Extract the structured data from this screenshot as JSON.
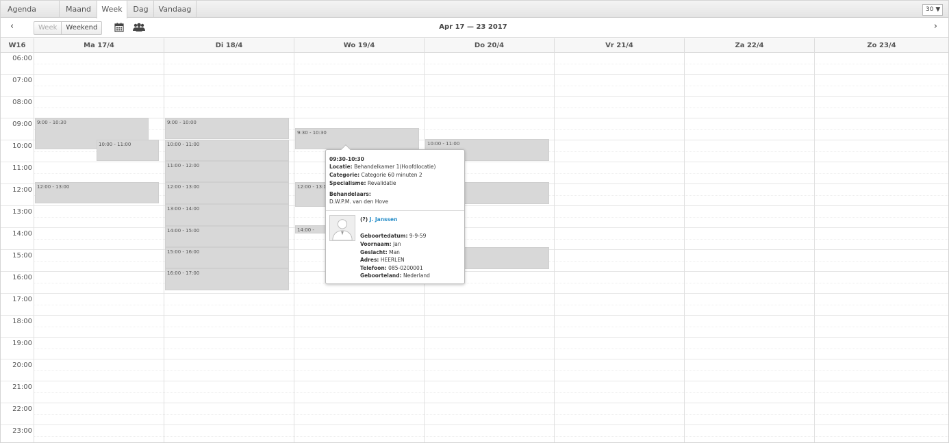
{
  "tabs": {
    "agenda": "Agenda",
    "maand": "Maand",
    "week": "Week",
    "dag": "Dag",
    "vandaag": "Vandaag"
  },
  "slot_select": "30 ▼",
  "toolbar": {
    "prev": "‹",
    "next": "›",
    "week_btn": "Week",
    "weekend_btn": "Weekend",
    "range_title": "Apr 17 — 23 2017",
    "calendar_icon": "calendar-icon",
    "people_icon": "people-icon"
  },
  "header": {
    "week_number": "W16",
    "days": [
      "Ma 17/4",
      "Di 18/4",
      "Wo 19/4",
      "Do 20/4",
      "Vr 21/4",
      "Za 22/4",
      "Zo 23/4"
    ]
  },
  "hours": [
    "06:00",
    "07:00",
    "08:00",
    "09:00",
    "10:00",
    "11:00",
    "12:00",
    "13:00",
    "14:00",
    "15:00",
    "16:00",
    "17:00",
    "18:00",
    "19:00",
    "20:00",
    "21:00",
    "22:00",
    "23:00"
  ],
  "events": [
    {
      "day": 0,
      "label": "9:00 - 10:30"
    },
    {
      "day": 0,
      "label": "10:00 - 11:00"
    },
    {
      "day": 0,
      "label": "12:00 - 13:00"
    },
    {
      "day": 1,
      "label": "9:00 - 10:00"
    },
    {
      "day": 1,
      "label": "10:00 - 11:00"
    },
    {
      "day": 1,
      "label": "11:00 - 12:00"
    },
    {
      "day": 1,
      "label": "12:00 - 13:00"
    },
    {
      "day": 1,
      "label": "13:00 - 14:00"
    },
    {
      "day": 1,
      "label": "14:00 - 15:00"
    },
    {
      "day": 1,
      "label": "15:00 - 16:00"
    },
    {
      "day": 1,
      "label": "16:00 - 17:00"
    },
    {
      "day": 2,
      "label": "9:30 - 10:30"
    },
    {
      "day": 2,
      "label": "12:00 - 13:10"
    },
    {
      "day": 2,
      "label": "14:00 -"
    },
    {
      "day": 3,
      "label": "10:00 - 11:00"
    },
    {
      "day": 3,
      "label": ""
    },
    {
      "day": 3,
      "label": ""
    }
  ],
  "popup": {
    "time": "09:30-10:30",
    "locatie_label": "Locatie:",
    "locatie": "Behandelkamer 1(Hoofdlocatie)",
    "categorie_label": "Categorie:",
    "categorie": "Categorie 60 minuten 2",
    "specialisme_label": "Specialisme:",
    "specialisme": "Revalidatie",
    "behandelaars_label": "Behandelaars:",
    "behandelaars": "D.W.P.M. van den Hove",
    "patient_prefix": "(?)",
    "patient_name": "J. Janssen",
    "geboortedatum_label": "Geboortedatum:",
    "geboortedatum": "9-9-59",
    "voornaam_label": "Voornaam:",
    "voornaam": "Jan",
    "geslacht_label": "Geslacht:",
    "geslacht": "Man",
    "adres_label": "Adres:",
    "adres": "HEERLEN",
    "telefoon_label": "Telefoon:",
    "telefoon": "085-0200001",
    "geboorteland_label": "Geboorteland:",
    "geboorteland": "Nederland"
  }
}
